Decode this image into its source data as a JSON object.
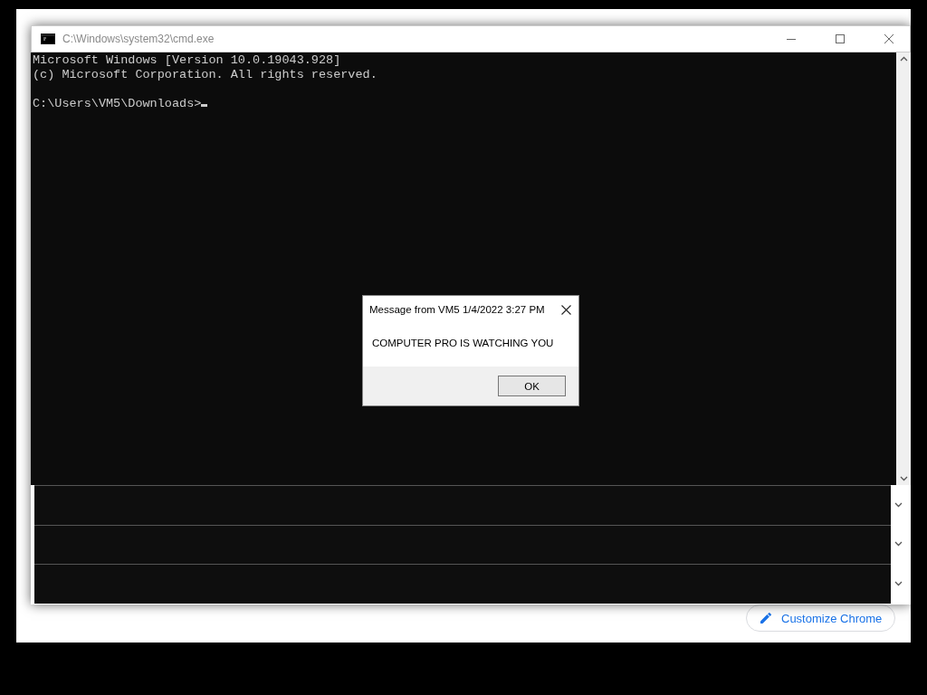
{
  "browser": {
    "customize_button": "Customize Chrome"
  },
  "console": {
    "title": "C:\\Windows\\system32\\cmd.exe",
    "lines": [
      "Microsoft Windows [Version 10.0.19043.928]",
      "(c) Microsoft Corporation. All rights reserved."
    ],
    "prompt": "C:\\Users\\VM5\\Downloads>"
  },
  "dialog": {
    "title": "Message from VM5 1/4/2022 3:27 PM",
    "message": "COMPUTER PRO IS WATCHING YOU",
    "buttons": [
      "OK"
    ]
  }
}
